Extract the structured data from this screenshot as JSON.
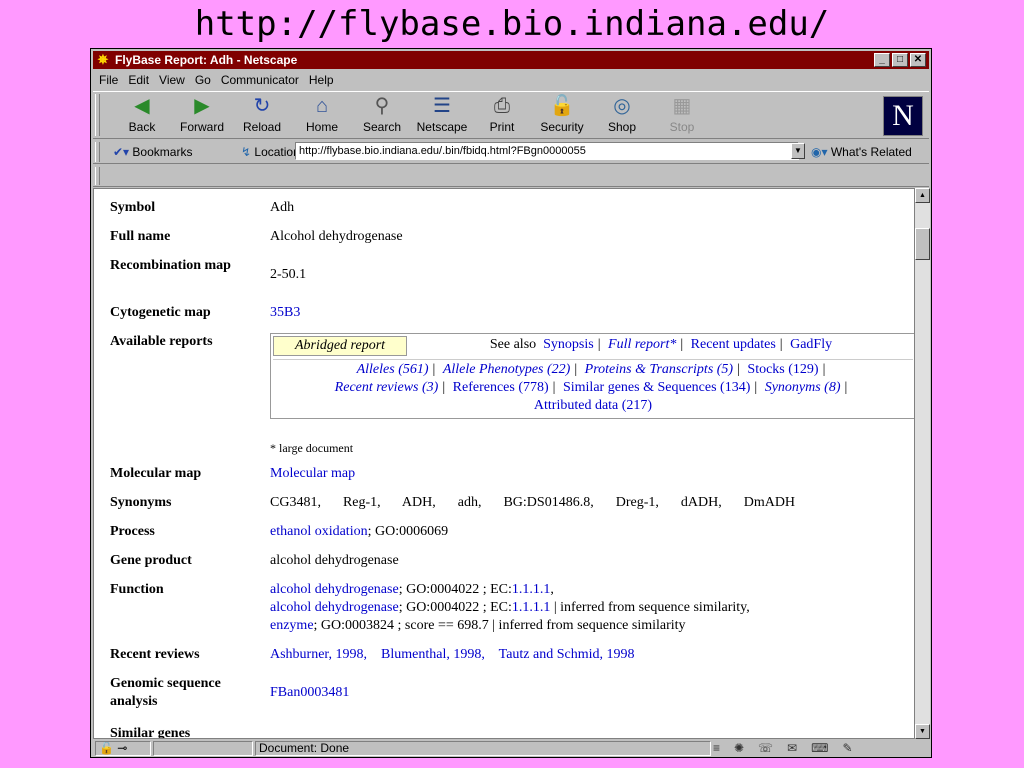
{
  "slide": {
    "title": "http://flybase.bio.indiana.edu/"
  },
  "window": {
    "title": "FlyBase Report: Adh - Netscape",
    "controls": {
      "minimize": "_",
      "maximize": "□",
      "close": "✕"
    },
    "menu": [
      "File",
      "Edit",
      "View",
      "Go",
      "Communicator",
      "Help"
    ],
    "toolbar": [
      {
        "label": "Back",
        "icon": "back-arrow-icon",
        "glyph": "◀"
      },
      {
        "label": "Forward",
        "icon": "forward-arrow-icon",
        "glyph": "▶"
      },
      {
        "label": "Reload",
        "icon": "reload-icon",
        "glyph": "↻"
      },
      {
        "label": "Home",
        "icon": "home-icon",
        "glyph": "⌂"
      },
      {
        "label": "Search",
        "icon": "search-icon",
        "glyph": "⚲"
      },
      {
        "label": "Netscape",
        "icon": "netscape-icon",
        "glyph": "☰"
      },
      {
        "label": "Print",
        "icon": "print-icon",
        "glyph": "⎙"
      },
      {
        "label": "Security",
        "icon": "lock-icon",
        "glyph": "🔓"
      },
      {
        "label": "Shop",
        "icon": "shop-icon",
        "glyph": "◎"
      },
      {
        "label": "Stop",
        "icon": "stop-icon",
        "glyph": "▦"
      }
    ],
    "logo": "N",
    "bookmarks_label": "Bookmarks",
    "location_label": "Location:",
    "location_url": "http://flybase.bio.indiana.edu/.bin/fbidq.html?FBgn0000055",
    "whats_related": "What's Related",
    "status_text": "Document: Done"
  },
  "report": {
    "symbol": {
      "label": "Symbol",
      "value": "Adh"
    },
    "full_name": {
      "label": "Full name",
      "value": "Alcohol dehydrogenase"
    },
    "recombination": {
      "label": "Recombination map",
      "value": "2-50.1"
    },
    "cytogenetic": {
      "label": "Cytogenetic map",
      "value": "35B3"
    },
    "available": {
      "label": "Available reports",
      "abridged": "Abridged report",
      "see_also": "See also",
      "top_links": [
        "Synopsis",
        "Full report*",
        "Recent updates",
        "GadFly"
      ],
      "links_line1": [
        "Alleles (561)",
        "Allele Phenotypes (22)",
        "Proteins & Transcripts (5)",
        "Stocks (129)"
      ],
      "links_line2": [
        "Recent reviews (3)",
        "References (778)",
        "Similar genes & Sequences (134)",
        "Synonyms (8)"
      ],
      "links_line3": "Attributed data (217)",
      "note": "* large document"
    },
    "molecular": {
      "label": "Molecular map",
      "value": "Molecular map"
    },
    "synonyms": {
      "label": "Synonyms",
      "values": [
        "CG3481,",
        "Reg-1,",
        "ADH,",
        "adh,",
        "BG:DS01486.8,",
        "Dreg-1,",
        "dADH,",
        "DmADH"
      ]
    },
    "process": {
      "label": "Process",
      "link": "ethanol oxidation",
      "rest": "; GO:0006069"
    },
    "gene_product": {
      "label": "Gene product",
      "value": "alcohol dehydrogenase"
    },
    "function": {
      "label": "Function",
      "l1_link": "alcohol dehydrogenase",
      "l1_mid": "; GO:0004022 ; EC:",
      "l1_ec": "1.1.1.1",
      "l1_end": ",",
      "l2_link": "alcohol dehydrogenase",
      "l2_mid": "; GO:0004022 ; EC:",
      "l2_ec": "1.1.1.1",
      "l2_end": " | inferred from sequence similarity,",
      "l3_link": "enzyme",
      "l3_rest": "; GO:0003824 ; score == 698.7 | inferred from sequence similarity"
    },
    "reviews": {
      "label": "Recent reviews",
      "values": [
        "Ashburner, 1998,",
        "Blumenthal, 1998,",
        "Tautz and Schmid, 1998"
      ]
    },
    "genomic": {
      "label": "Genomic sequence analysis",
      "value": "FBan0003481"
    },
    "similar": {
      "label": "Similar genes"
    }
  }
}
